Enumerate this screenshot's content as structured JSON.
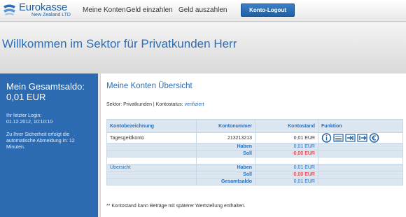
{
  "logo": {
    "title": "Eurokasse",
    "subtitle": "New Zealand LTD"
  },
  "nav": {
    "items": [
      "Meine Konten",
      "Geld einzahlen",
      "Geld auszahlen"
    ],
    "logout": "Konto-Logout"
  },
  "welcome": {
    "text": "Willkommen im Sektor für Privatkunden Herr"
  },
  "sidebar": {
    "saldo_label": "Mein Gesamtsaldo:",
    "saldo_value": "0,01 EUR",
    "login_label": "Ihr letzter Login:",
    "login_date": "01.12.2012, 10:10:10",
    "logout_note": "Zu Ihrer Sicherheit erfolgt die automatische Abmeldung in: 12 Minuten."
  },
  "main": {
    "title": "Meine Konten Übersicht",
    "sector_prefix": "Sektor: Privatkunden | Kontostatus:",
    "status": "verifiziert",
    "columns": [
      "Kontobezeichnung",
      "Kontonummer",
      "Kontostand",
      "Funktion"
    ],
    "account": {
      "name": "Tagesgeldkonto",
      "number": "213213213",
      "balance": "0,01 EUR"
    },
    "subtotal": {
      "haben_label": "Haben",
      "haben_value": "0,01 EUR",
      "soll_label": "Soll",
      "soll_value": "-0,00 EUR"
    },
    "summary": {
      "link": "Übersicht",
      "haben_label": "Haben",
      "haben_value": "0,01 EUR",
      "soll_label": "Soll",
      "soll_value": "-0,00 EUR",
      "total_label": "Gesamtsaldo",
      "total_value": "0,01 EUR"
    },
    "footnote": "** Kontostand kann Beträge mit späterer Wertstellung enthalten.",
    "function_icons": [
      "info-icon",
      "statement-icon",
      "transfer-icon",
      "transfer-out-icon",
      "euro-icon"
    ]
  },
  "colors": {
    "accent": "#2b6eb5",
    "panel": "#2c6bb2",
    "negative": "#d21b1b",
    "table_header": "#dbe6f1"
  }
}
